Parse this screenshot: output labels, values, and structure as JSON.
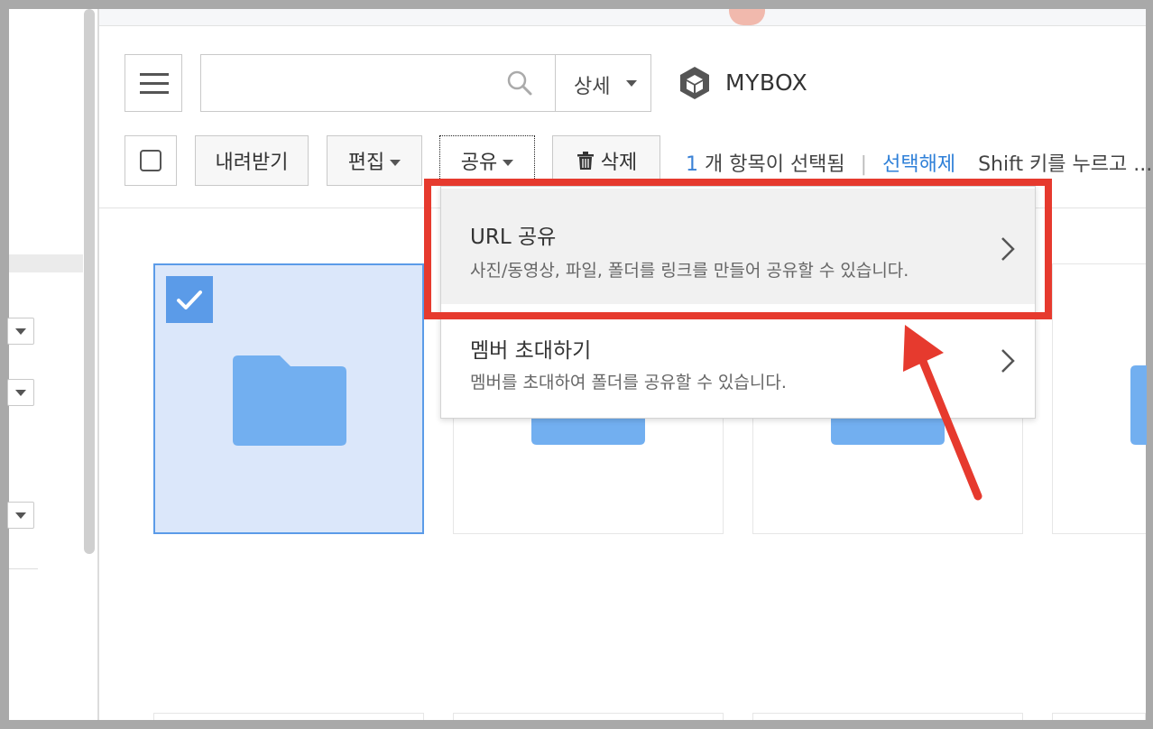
{
  "search": {
    "placeholder": "",
    "detail_label": "상세"
  },
  "brand": {
    "name": "MYBOX"
  },
  "toolbar": {
    "download_label": "내려받기",
    "edit_label": "편집",
    "share_label": "공유",
    "delete_label": "삭제"
  },
  "selection": {
    "count": "1",
    "text": "개 항목이 선택됨",
    "separator": "|",
    "clear_label": "선택해제",
    "hint": "Shift 키를 누르고 ..."
  },
  "share_menu": {
    "items": [
      {
        "title": "URL 공유",
        "description": "사진/동영상, 파일, 폴더를 링크를 만들어 공유할 수 있습니다."
      },
      {
        "title": "멤버 초대하기",
        "description": "멤버를 초대하여 폴더를 공유할 수 있습니다."
      }
    ]
  },
  "colors": {
    "accent": "#5b9be8",
    "folder": "#72aff0",
    "annotation_red": "#e63a2e",
    "link": "#2f80d8"
  },
  "icons": [
    "menu-icon",
    "search-icon",
    "chevron-down-icon",
    "mybox-logo-icon",
    "checkbox-icon",
    "trash-icon",
    "folder-icon",
    "check-icon",
    "chevron-right-icon"
  ]
}
